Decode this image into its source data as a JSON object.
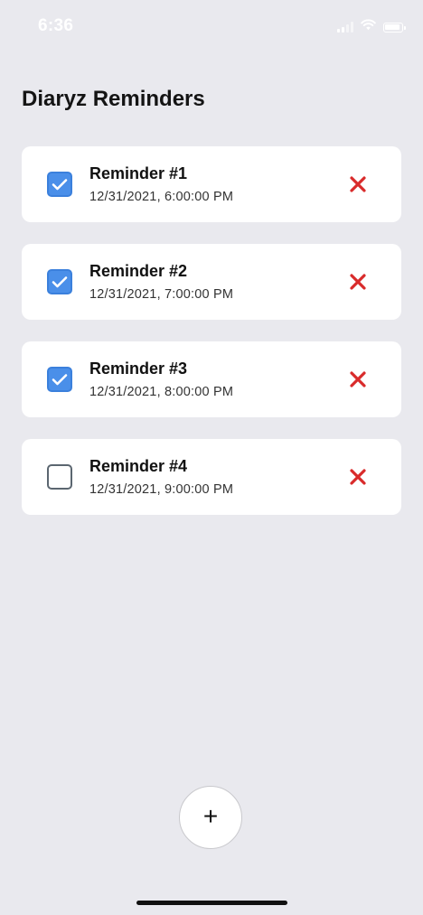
{
  "status_bar": {
    "time": "6:36",
    "icons": [
      "cellular-signal-icon",
      "wifi-icon",
      "battery-icon"
    ]
  },
  "header": {
    "title": "Diaryz Reminders"
  },
  "reminders": [
    {
      "title": "Reminder #1",
      "datetime": "12/31/2021, 6:00:00 PM",
      "checked": true
    },
    {
      "title": "Reminder #2",
      "datetime": "12/31/2021, 7:00:00 PM",
      "checked": true
    },
    {
      "title": "Reminder #3",
      "datetime": "12/31/2021, 8:00:00 PM",
      "checked": true
    },
    {
      "title": "Reminder #4",
      "datetime": "12/31/2021, 9:00:00 PM",
      "checked": false
    }
  ],
  "add_button": {
    "label": "+"
  },
  "colors": {
    "background": "#e9e9ee",
    "card": "#ffffff",
    "checkbox_checked": "#4a8fe9",
    "checkbox_unchecked_border": "#5b6670",
    "delete": "#d92b2b"
  }
}
